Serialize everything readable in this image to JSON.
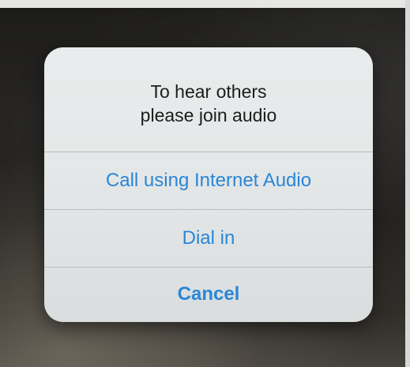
{
  "dialog": {
    "message_line1": "To hear others",
    "message_line2": "please join audio",
    "actions": [
      {
        "label": "Call using Internet Audio"
      },
      {
        "label": "Dial in"
      },
      {
        "label": "Cancel"
      }
    ]
  },
  "colors": {
    "action_text": "#2a86d8",
    "message_text": "#1c1c1c",
    "dialog_background": "#e6e9e9"
  }
}
